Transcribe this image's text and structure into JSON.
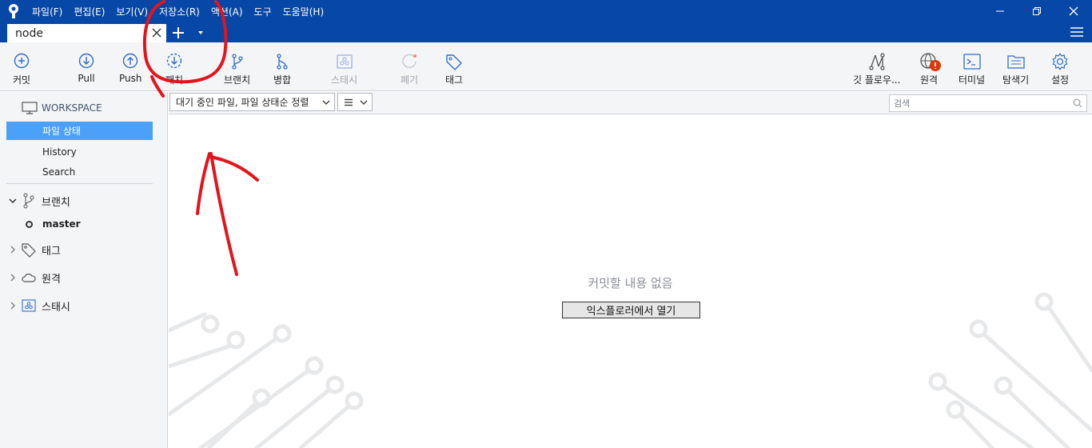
{
  "menu": [
    "파일(F)",
    "편집(E)",
    "보기(V)",
    "저장소(R)",
    "액션(A)",
    "도구",
    "도움말(H)"
  ],
  "tab": {
    "label": "node"
  },
  "toolbar": {
    "commit": "커밋",
    "pull": "Pull",
    "push": "Push",
    "fetch": "패치",
    "branch": "브랜치",
    "merge": "병합",
    "stash": "스태시",
    "discard": "폐기",
    "tag": "태그",
    "gitflow": "깃 플로우...",
    "remote": "원격",
    "terminal": "터미널",
    "explorer": "탐색기",
    "settings": "설정"
  },
  "sidebar": {
    "workspace": "WORKSPACE",
    "items": [
      "파일 상태",
      "History",
      "Search"
    ],
    "branches": "브랜치",
    "current_branch": "master",
    "tags": "태그",
    "remotes": "원격",
    "stashes": "스태시"
  },
  "filter": {
    "sort_label": "대기 중인 파일, 파일 상태순 정렬",
    "view_icon": "list-icon",
    "search_placeholder": "검색"
  },
  "main": {
    "empty_message": "커밋할 내용 없음",
    "open_explorer_label": "익스플로러에서 열기"
  },
  "colors": {
    "titlebar": "#0747a6",
    "accent": "#4ba0f7",
    "icon_blue": "#2e6dcc",
    "annotation": "#e3141c",
    "badge": "#de350b"
  }
}
